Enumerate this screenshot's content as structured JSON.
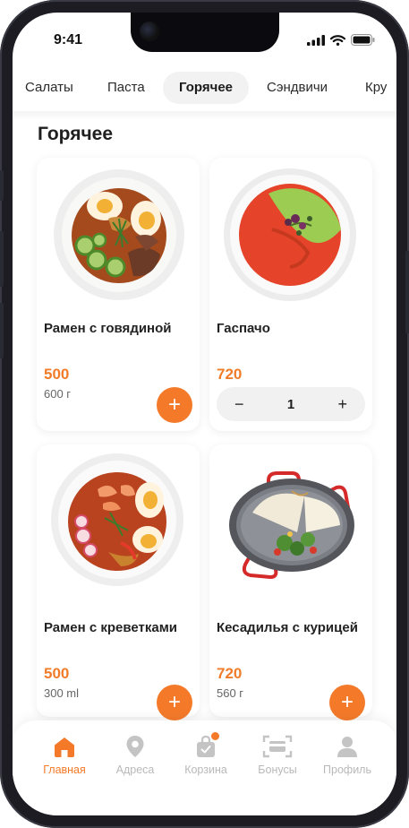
{
  "status": {
    "time": "9:41"
  },
  "categories": [
    {
      "label": "Салаты",
      "active": false
    },
    {
      "label": "Паста",
      "active": false
    },
    {
      "label": "Горячее",
      "active": true
    },
    {
      "label": "Сэндвичи",
      "active": false
    },
    {
      "label": "Кру",
      "active": false
    }
  ],
  "section": {
    "title": "Горячее"
  },
  "products": [
    {
      "name": "Рамен с говядиной",
      "price": "500",
      "weight": "600 г",
      "action": "+"
    },
    {
      "name": "Гаспачо",
      "price": "720",
      "quantity": "1",
      "minus": "−",
      "plus": "+"
    },
    {
      "name": "Рамен с креветками",
      "price": "500",
      "weight": "300 ml",
      "action": "+"
    },
    {
      "name": "Кесадилья с курицей",
      "price": "720",
      "weight": "560 г",
      "action": "+"
    }
  ],
  "tabs": [
    {
      "label": "Главная",
      "icon": "home-icon",
      "active": true
    },
    {
      "label": "Адреса",
      "icon": "location-pin-icon",
      "active": false
    },
    {
      "label": "Корзина",
      "icon": "cart-bag-icon",
      "active": false
    },
    {
      "label": "Бонусы",
      "icon": "bonus-card-icon",
      "active": false
    },
    {
      "label": "Профиль",
      "icon": "user-icon",
      "active": false
    }
  ],
  "colors": {
    "accent": "#f47a2a",
    "price": "#f07c2a",
    "inactive_tab": "#b9b9b9"
  }
}
